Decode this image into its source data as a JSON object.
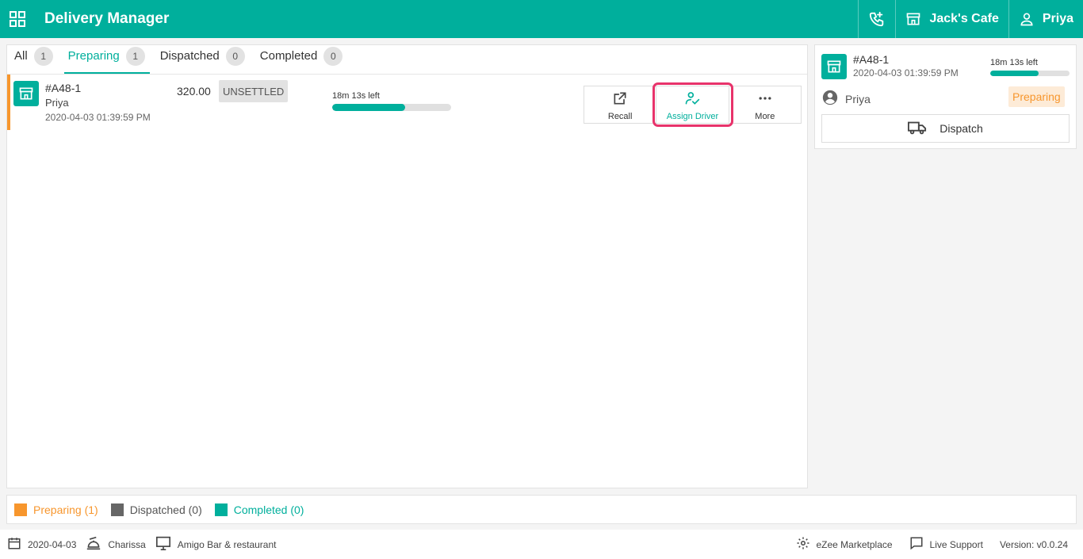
{
  "header": {
    "title": "Delivery Manager",
    "store_name": "Jack's Cafe",
    "user_name": "Priya"
  },
  "tabs": [
    {
      "label": "All",
      "count": "1"
    },
    {
      "label": "Preparing",
      "count": "1"
    },
    {
      "label": "Dispatched",
      "count": "0"
    },
    {
      "label": "Completed",
      "count": "0"
    }
  ],
  "order": {
    "id": "#A48-1",
    "customer": "Priya",
    "datetime": "2020-04-03 01:39:59 PM",
    "amount": "320.00",
    "payment_status": "UNSETTLED",
    "time_left": "18m 13s left",
    "progress_fraction": 0.61,
    "actions": {
      "recall": "Recall",
      "assign_driver": "Assign Driver",
      "more": "More"
    }
  },
  "detail": {
    "id": "#A48-1",
    "datetime": "2020-04-03 01:39:59 PM",
    "time_left": "18m 13s left",
    "progress_fraction": 0.61,
    "customer": "Priya",
    "status": "Preparing",
    "dispatch_label": "Dispatch"
  },
  "legend": [
    {
      "label": "Preparing (1)",
      "color": "#f7962d",
      "text_color": "#f7962d"
    },
    {
      "label": "Dispatched (0)",
      "color": "#666666",
      "text_color": "#555555"
    },
    {
      "label": "Completed (0)",
      "color": "#00af9c",
      "text_color": "#00af9c"
    }
  ],
  "footer": {
    "date": "2020-04-03",
    "staff": "Charissa",
    "outlet": "Amigo Bar & restaurant",
    "marketplace": "eZee Marketplace",
    "support": "Live Support",
    "version": "Version: v0.0.24"
  },
  "colors": {
    "brand": "#00af9c",
    "preparing": "#f7962d",
    "highlight": "#e8336b"
  }
}
